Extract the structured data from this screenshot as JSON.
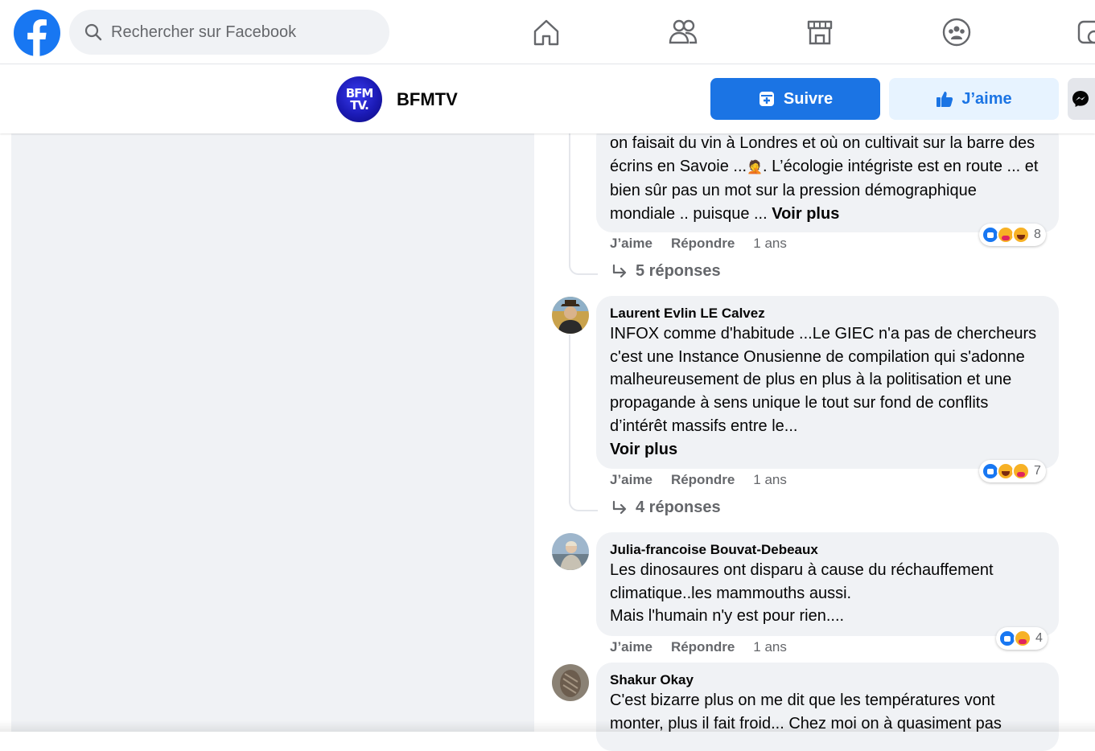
{
  "topnav": {
    "search_placeholder": "Rechercher sur Facebook",
    "icons": [
      "facebook-logo",
      "home-icon",
      "friends-icon",
      "marketplace-icon",
      "groups-icon",
      "gaming-icon"
    ]
  },
  "page": {
    "name": "BFMTV",
    "logo_text_top": "BFM",
    "logo_text_bottom": "TV.",
    "follow_label": "Suivre",
    "like_label": "J’aime"
  },
  "colors": {
    "accent": "#1b74e4",
    "like_bg": "#e7f3ff",
    "bubble_bg": "#f0f2f5",
    "left_panel_bg": "#f0f2f5"
  },
  "comments": [
    {
      "author": "",
      "text_before": "on faisait du vin à Londres et où on cultivait sur la barre des écrins en Savoie ...",
      "emoji": "🤦",
      "text_after": ". L’écologie intégriste est en route ... et bien sûr pas un mot sur la pression démographique mondiale .. puisque ... ",
      "more": "Voir plus",
      "like": "J’aime",
      "reply": "Répondre",
      "time": "1 ans",
      "reaction_count": "8",
      "reactions": [
        "like",
        "care",
        "haha"
      ],
      "replies": "5 réponses"
    },
    {
      "author": "Laurent Evlin LE Calvez",
      "text": "INFOX comme d'habitude ...Le GIEC n'a pas de chercheurs c'est une Instance Onusienne de compilation qui s'adonne malheureusement de plus en plus à la politisation et une propagande à sens unique le tout sur fond de conflits d’intérêt massifs entre le...",
      "more": "Voir plus",
      "like": "J’aime",
      "reply": "Répondre",
      "time": "1 ans",
      "reaction_count": "7",
      "reactions": [
        "like",
        "haha",
        "care"
      ],
      "replies": "4 réponses"
    },
    {
      "author": "Julia-francoise Bouvat-Debeaux",
      "line1": "Les dinosaures ont disparu à cause du réchauffement climatique..les mammouths aussi.",
      "line2": "Mais l'humain n'y est pour rien....",
      "like": "J’aime",
      "reply": "Répondre",
      "time": "1 ans",
      "reaction_count": "4",
      "reactions": [
        "like",
        "care"
      ]
    },
    {
      "author": "Shakur Okay",
      "text": "C'est bizarre plus on me dit que les températures vont monter, plus il fait froid... Chez moi on à quasiment pas"
    }
  ]
}
